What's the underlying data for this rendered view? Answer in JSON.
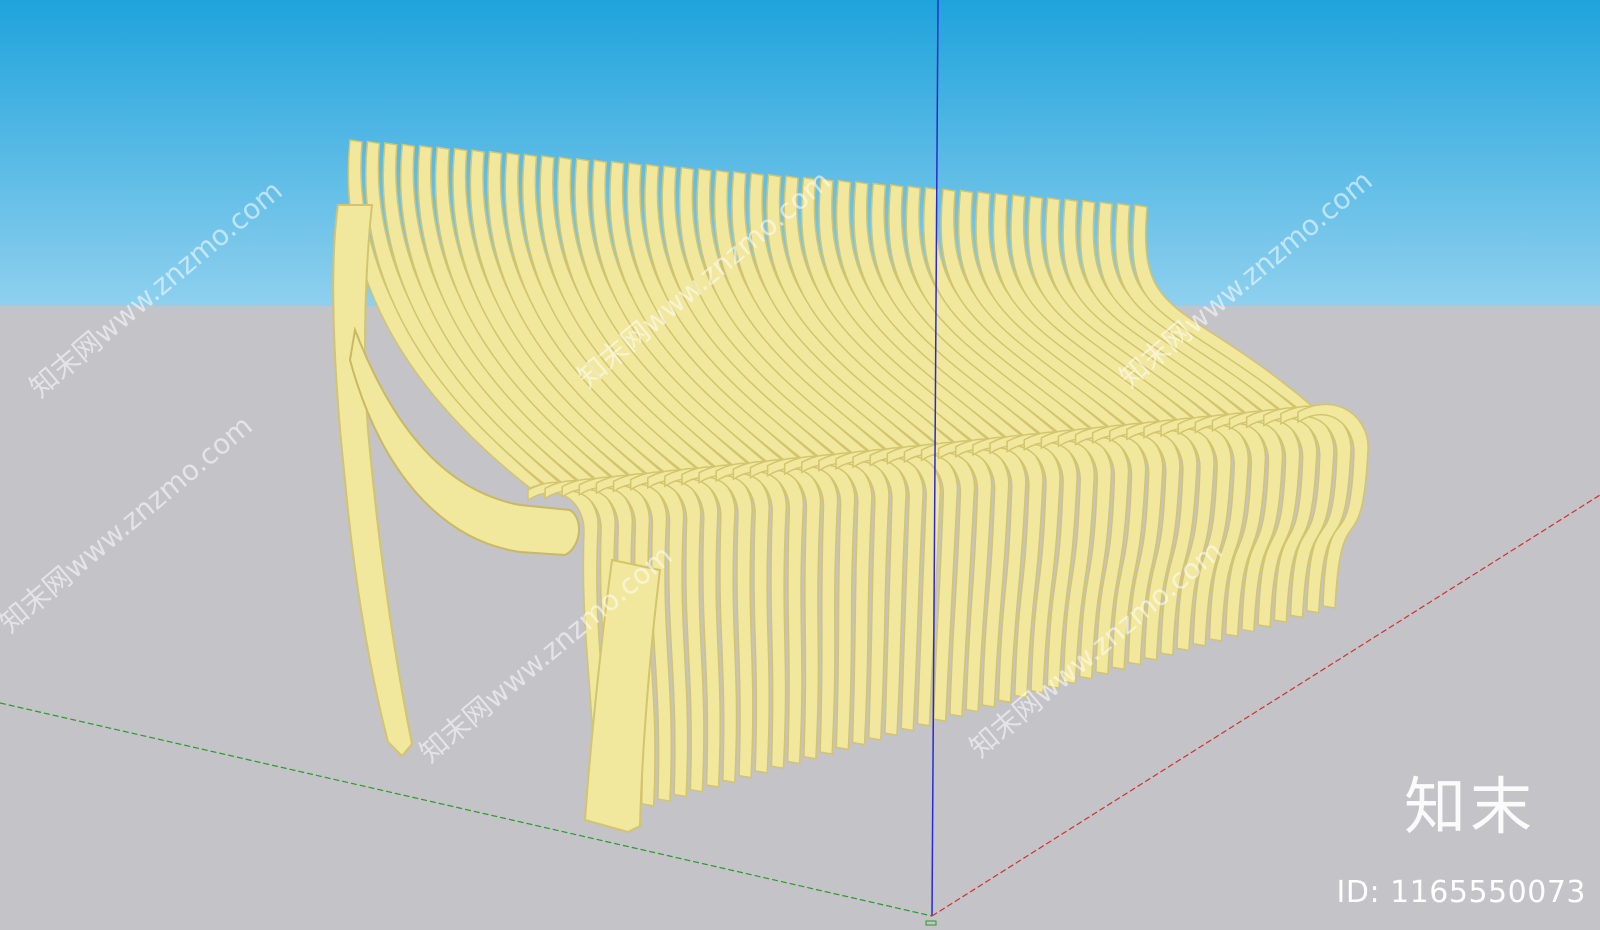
{
  "viewport": {
    "sky_top": "#1fa3dc",
    "sky_bottom": "#8fd0ee",
    "ground": "#c3c3c8",
    "model_fill": "#f1e89e",
    "model_slat_edge": "#d3c46e",
    "model_outline": "#3a3a2a",
    "axis_red": "#d2302f",
    "axis_green": "#2a9a2a",
    "axis_blue": "#2a2ad0"
  },
  "watermark": {
    "text": "知末网www.znzmo.com",
    "brand": "知末",
    "id_label": "ID: 1165550073"
  }
}
